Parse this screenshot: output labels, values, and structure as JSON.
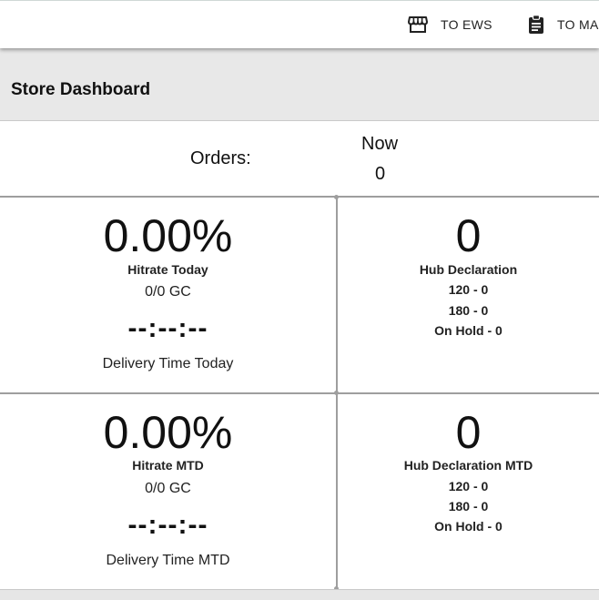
{
  "nav": {
    "ews_label": "TO EWS",
    "ews_icon": "store-icon",
    "ma_label": "TO MA",
    "ma_icon": "clipboard-icon"
  },
  "page": {
    "title": "Store Dashboard"
  },
  "orders": {
    "label": "Orders:",
    "now_label": "Now",
    "now_value": "0"
  },
  "today": {
    "hitrate_value": "0.00%",
    "hitrate_label": "Hitrate Today",
    "gc": "0/0 GC",
    "time_value": "--:--:--",
    "time_label": "Delivery Time Today"
  },
  "hub_today": {
    "value": "0",
    "label": "Hub Declaration",
    "line_120": "120 - 0",
    "line_180": "180 - 0",
    "on_hold": "On Hold - 0"
  },
  "mtd": {
    "hitrate_value": "0.00%",
    "hitrate_label": "Hitrate MTD",
    "gc": "0/0 GC",
    "time_value": "--:--:--",
    "time_label": "Delivery Time MTD"
  },
  "hub_mtd": {
    "value": "0",
    "label": "Hub Declaration MTD",
    "line_120": "120 - 0",
    "line_180": "180 - 0",
    "on_hold": "On Hold - 0"
  }
}
